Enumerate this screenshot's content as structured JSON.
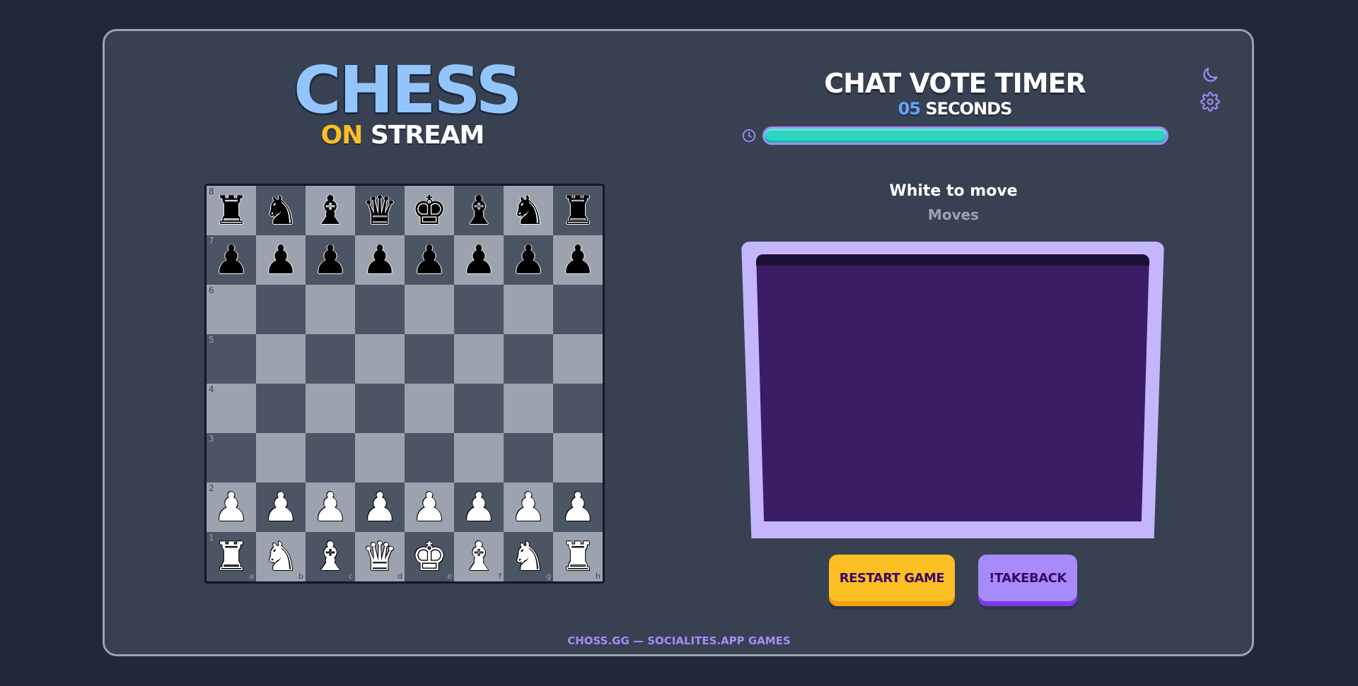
{
  "logo": {
    "main": "CHESS",
    "sub_on": "ON",
    "sub_stream": "STREAM"
  },
  "timer": {
    "title": "CHAT VOTE TIMER",
    "seconds_value": "05",
    "seconds_label": " SECONDS",
    "progress_fraction": 1.0
  },
  "status": {
    "to_move": "White to move",
    "moves_label": "Moves"
  },
  "buttons": {
    "restart": "RESTART GAME",
    "takeback": "!TAKEBACK"
  },
  "footer": "CHOSS.GG — SOCIALITES.APP GAMES",
  "icons": {
    "theme": "moon-icon",
    "settings": "gear-icon",
    "timer": "clock-icon"
  },
  "colors": {
    "accent": "#a78bfa",
    "logo": "#93c5fd",
    "on": "#fbbf24",
    "timer_fill": "#2dd4bf"
  },
  "board": {
    "files": [
      "a",
      "b",
      "c",
      "d",
      "e",
      "f",
      "g",
      "h"
    ],
    "ranks": [
      "8",
      "7",
      "6",
      "5",
      "4",
      "3",
      "2",
      "1"
    ],
    "position": [
      [
        "bR",
        "bN",
        "bB",
        "bQ",
        "bK",
        "bB",
        "bN",
        "bR"
      ],
      [
        "bP",
        "bP",
        "bP",
        "bP",
        "bP",
        "bP",
        "bP",
        "bP"
      ],
      [
        "",
        "",
        "",
        "",
        "",
        "",
        "",
        ""
      ],
      [
        "",
        "",
        "",
        "",
        "",
        "",
        "",
        ""
      ],
      [
        "",
        "",
        "",
        "",
        "",
        "",
        "",
        ""
      ],
      [
        "",
        "",
        "",
        "",
        "",
        "",
        "",
        ""
      ],
      [
        "wP",
        "wP",
        "wP",
        "wP",
        "wP",
        "wP",
        "wP",
        "wP"
      ],
      [
        "wR",
        "wN",
        "wB",
        "wQ",
        "wK",
        "wB",
        "wN",
        "wR"
      ]
    ]
  }
}
